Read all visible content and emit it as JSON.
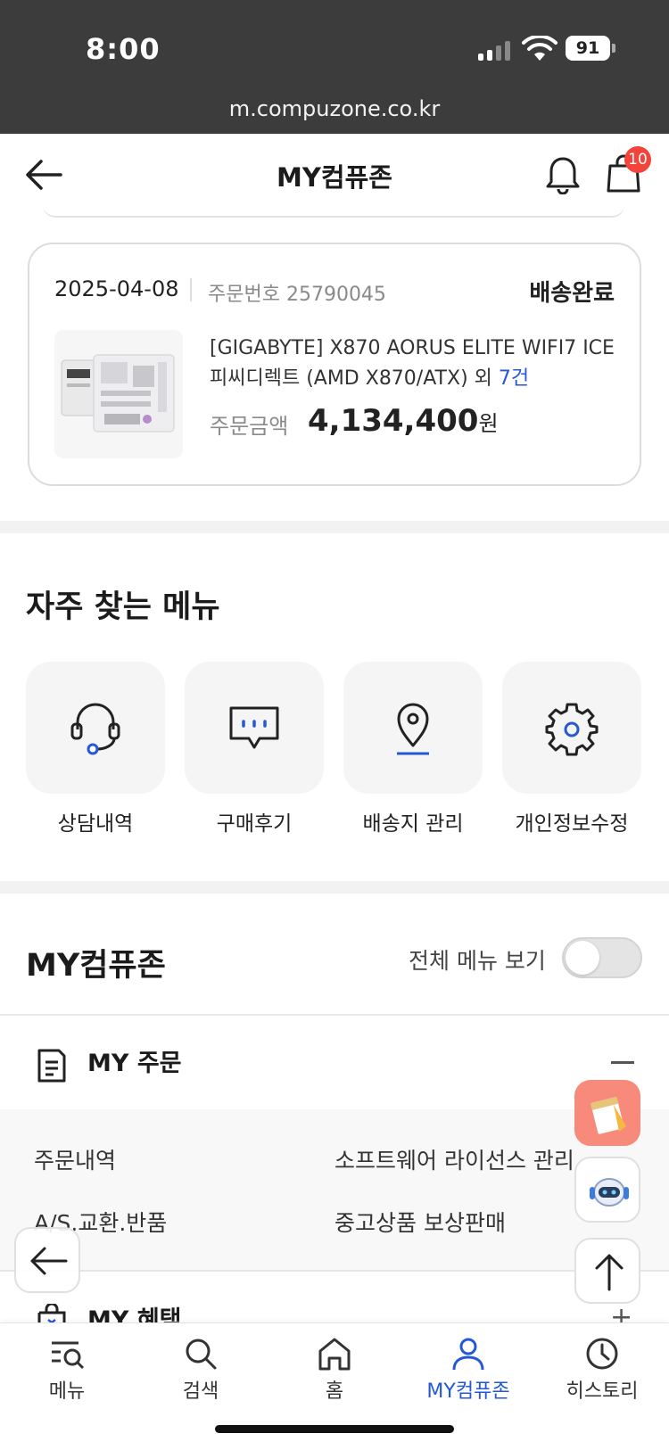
{
  "status_bar": {
    "time": "8:00",
    "battery": "91",
    "url": "m.compuzone.co.kr"
  },
  "header": {
    "title": "MY컴퓨존",
    "cart_count": "10"
  },
  "order": {
    "date": "2025-04-08",
    "order_number": "주문번호 25790045",
    "status": "배송완료",
    "product_name": "[GIGABYTE] X870 AORUS ELITE WIFI7 ICE 피씨디렉트 (AMD X870/ATX) 외",
    "more_count": "7건",
    "amount_label": "주문금액",
    "amount": "4,134,400",
    "currency": "원"
  },
  "frequent_menu": {
    "title": "자주 찾는 메뉴",
    "items": [
      {
        "label": "상담내역",
        "icon": "headset-icon"
      },
      {
        "label": "구매후기",
        "icon": "chat-icon"
      },
      {
        "label": "배송지 관리",
        "icon": "location-pin-icon"
      },
      {
        "label": "개인정보수정",
        "icon": "gear-icon"
      }
    ]
  },
  "my_section": {
    "title": "MY컴퓨존",
    "all_menu_label": "전체 메뉴 보기",
    "all_menu_on": false,
    "order_group": {
      "label": "MY 주문",
      "items": [
        "주문내역",
        "소프트웨어 라이선스 관리",
        "A/S.교환.반품",
        "중고상품 보상판매"
      ]
    },
    "benefit_group": {
      "label": "MY 혜택"
    }
  },
  "tabbar": {
    "items": [
      {
        "label": "메뉴",
        "icon": "menu-search-icon"
      },
      {
        "label": "검색",
        "icon": "search-icon"
      },
      {
        "label": "홈",
        "icon": "home-icon"
      },
      {
        "label": "MY컴퓨존",
        "icon": "person-icon",
        "active": true
      },
      {
        "label": "히스토리",
        "icon": "clock-icon"
      }
    ]
  },
  "colors": {
    "accent": "#2458d6",
    "badge": "#f2443b",
    "memo_fab": "#f88a7b"
  }
}
